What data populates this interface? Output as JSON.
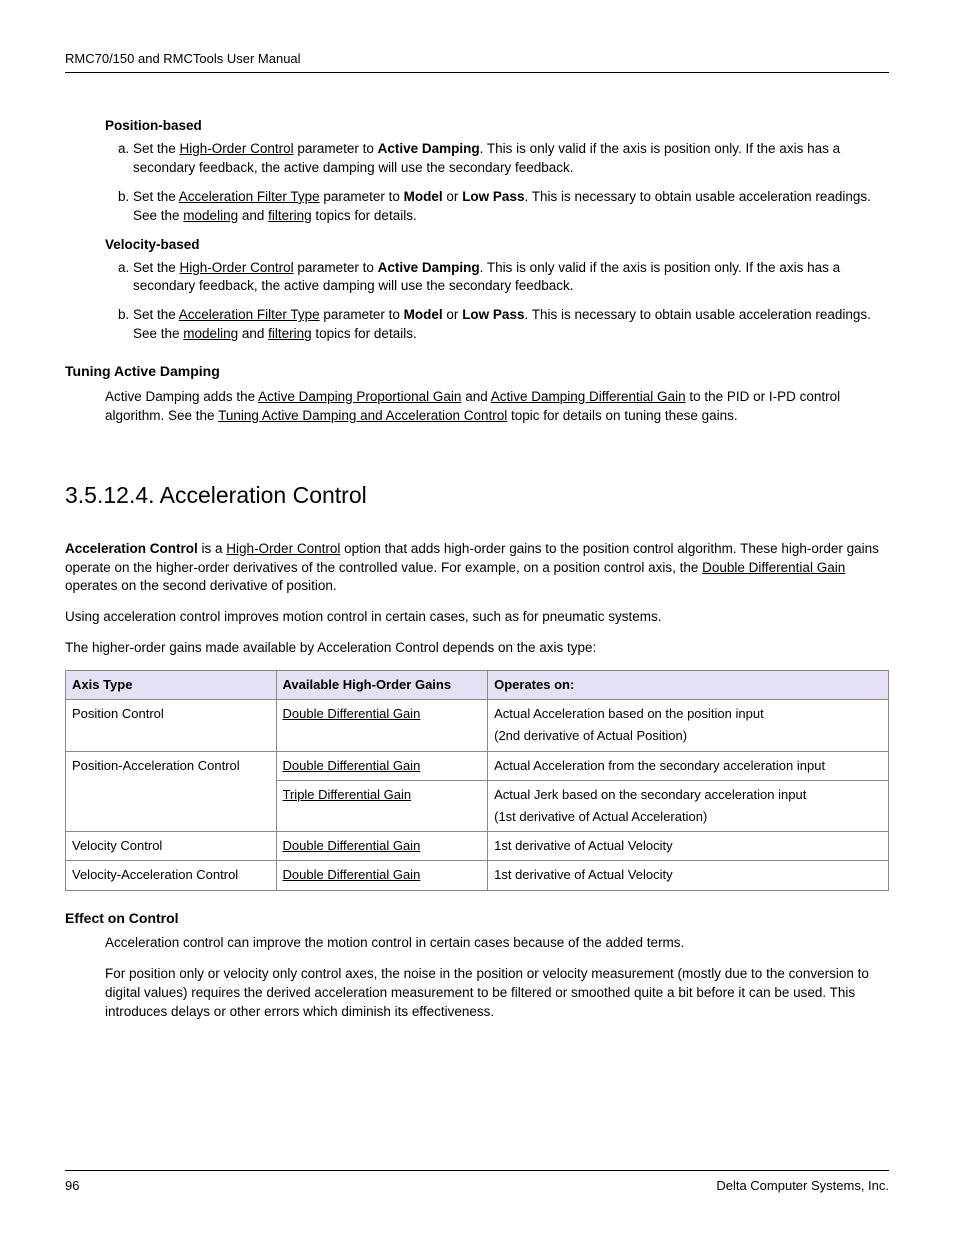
{
  "header": "RMC70/150 and RMCTools User Manual",
  "positionBased": {
    "title": "Position-based",
    "a": {
      "pre": "Set the ",
      "link": "High-Order Control",
      "mid": " parameter to ",
      "bold": "Active Damping",
      "post": ". This is only valid if the axis is position only. If the axis has a secondary feedback, the active damping will use the secondary feedback."
    },
    "b": {
      "pre": "Set the ",
      "link": "Acceleration Filter Type",
      "mid1": " parameter to ",
      "bold1": "Model",
      "or": " or ",
      "bold2": "Low Pass",
      "mid2": ". This is necessary to obtain usable acceleration readings. See the ",
      "link2": "modeling",
      "and": " and ",
      "link3": "filtering",
      "post": " topics for details."
    }
  },
  "velocityBased": {
    "title": "Velocity-based",
    "a": {
      "pre": "Set the ",
      "link": "High-Order Control",
      "mid": " parameter to ",
      "bold": "Active Damping",
      "post": ". This is only valid if the axis is position only. If the axis has a secondary feedback, the active damping will use the secondary feedback."
    },
    "b": {
      "pre": "Set the ",
      "link": "Acceleration Filter Type",
      "mid1": " parameter to ",
      "bold1": "Model",
      "or": " or ",
      "bold2": "Low Pass",
      "mid2": ". This is necessary to obtain usable acceleration readings. See the ",
      "link2": "modeling",
      "and": " and ",
      "link3": "filtering",
      "post": " topics for details."
    }
  },
  "tuning": {
    "title": "Tuning Active Damping",
    "p1_a": "Active Damping adds the ",
    "p1_l1": "Active Damping Proportional Gain",
    "p1_b": " and ",
    "p1_l2": "Active Damping Differential Gain",
    "p1_c": " to the PID or I-PD control algorithm. See the ",
    "p1_l3": "Tuning Active Damping and Acceleration Control",
    "p1_d": " topic for details on tuning these gains."
  },
  "accel": {
    "title": "3.5.12.4. Acceleration Control",
    "p1_bold": "Acceleration Control",
    "p1_a": " is a ",
    "p1_l1": "High-Order Control",
    "p1_b": " option that adds high-order gains to the position control algorithm. These high-order gains operate on the higher-order derivatives of the controlled value. For example, on a position control axis, the ",
    "p1_l2": "Double Differential Gain",
    "p1_c": " operates on the second derivative of position.",
    "p2": "Using acceleration control improves motion control in certain cases, such as for pneumatic systems.",
    "p3": "The higher-order gains made available by Acceleration Control depends on the axis type:"
  },
  "table": {
    "h1": "Axis Type",
    "h2": "Available High-Order Gains",
    "h3": "Operates on:",
    "r1": {
      "c1": "Position Control",
      "c2": "Double Differential Gain",
      "c3a": "Actual Acceleration based on the position input",
      "c3b": "(2nd derivative of Actual Position)"
    },
    "r2": {
      "c1": "Position-Acceleration Control",
      "c2a": "Double Differential Gain",
      "c3a": "Actual Acceleration from the secondary acceleration input",
      "c2b": "Triple Differential Gain",
      "c3b": "Actual Jerk based on the secondary acceleration input",
      "c3c": "(1st derivative of Actual Acceleration)"
    },
    "r3": {
      "c1": "Velocity Control",
      "c2": "Double Differential Gain",
      "c3": "1st derivative of Actual Velocity"
    },
    "r4": {
      "c1": "Velocity-Acceleration Control",
      "c2": "Double Differential Gain",
      "c3": "1st derivative of Actual Velocity"
    }
  },
  "effect": {
    "title": "Effect on Control",
    "p1": "Acceleration control can improve the motion control in certain cases because of the added terms.",
    "p2": "For position only or velocity only control axes, the noise in the position or velocity measurement (mostly due to the conversion to digital values) requires the derived acceleration measurement to be filtered or smoothed quite a bit before it can be used. This introduces delays or other errors which diminish its effectiveness."
  },
  "footer": {
    "page": "96",
    "company": "Delta Computer Systems, Inc."
  }
}
